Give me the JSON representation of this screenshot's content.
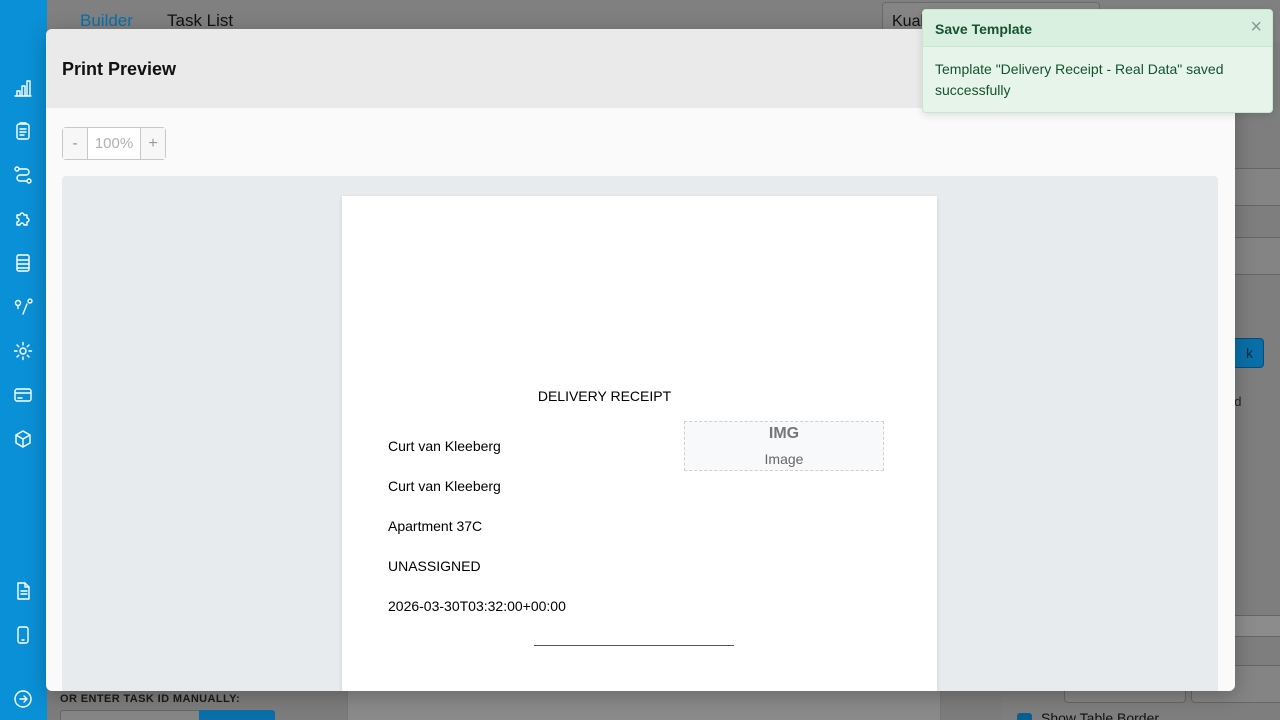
{
  "sidebar": {
    "icons": [
      "bar-chart-icon",
      "clipboard-icon",
      "route-icon",
      "puzzle-icon",
      "document-list-icon",
      "map-pin-route-icon",
      "gear-icon",
      "credit-card-icon",
      "box-icon",
      "file-text-icon",
      "mobile-icon",
      "logout-icon"
    ]
  },
  "background": {
    "tabs": [
      "Builder",
      "Task List"
    ],
    "select_value": "Kual",
    "right_fragments": [
      "k",
      "ed"
    ],
    "show_table_border": "Show Table Border",
    "manual_label": "OR ENTER TASK ID MANUALLY:"
  },
  "modal": {
    "title": "Print Preview",
    "zoom": {
      "minus": "-",
      "value": "100%",
      "plus": "+"
    },
    "document": {
      "title": "DELIVERY RECEIPT",
      "lines": [
        "Curt van Kleeberg",
        "Curt van Kleeberg",
        "Apartment 37C",
        "UNASSIGNED",
        "2026-03-30T03:32:00+00:00"
      ],
      "image_tag": "IMG",
      "image_label": "Image"
    }
  },
  "toast": {
    "title": "Save Template",
    "close": "×",
    "message": "Template \"Delivery Receipt - Real Data\" saved successfully"
  }
}
